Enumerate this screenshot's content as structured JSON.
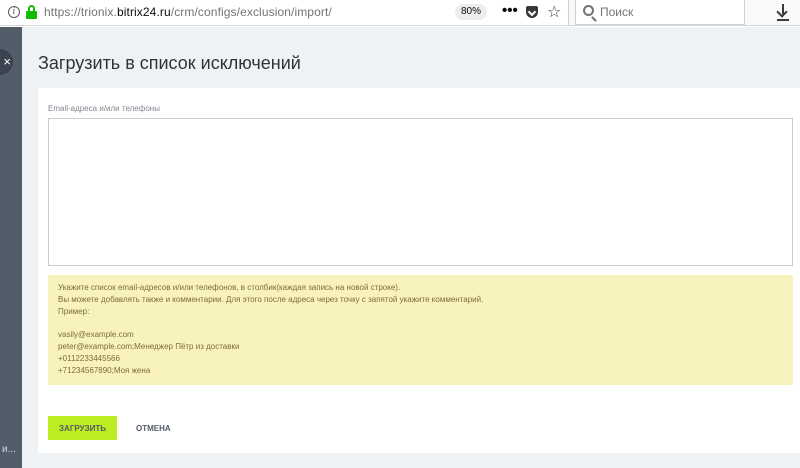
{
  "browser": {
    "url_prefix": "https://trionix.",
    "url_host": "bitrix24.ru",
    "url_path": "/crm/configs/exclusion/import/",
    "zoom": "80%",
    "search_placeholder": "Поиск",
    "icons": [
      "info-icon",
      "lock-icon",
      "menu-dots-icon",
      "pocket-icon",
      "star-icon",
      "search-icon",
      "download-icon"
    ]
  },
  "sidebar": {
    "close_glyph": "×",
    "cut_text": "и..."
  },
  "page": {
    "title": "Загрузить в список исключений",
    "field_label": "Email-адреса и/или телефоны",
    "textarea_value": "",
    "hint_lines": [
      "Укажите список email-адресов и/или телефонов, в столбик(каждая запись на новой строке).",
      "Вы можете добавлять также и комментарии. Для этого после адреса через точку с запятой укажите комментарий.",
      "Пример:",
      "",
      "vasily@example.com",
      "peter@example.com;Менеджер Пётр из доставки",
      "+0112233445566",
      "+71234567890;Моя жена"
    ],
    "upload_button": "ЗАГРУЗИТЬ",
    "cancel_button": "ОТМЕНА"
  },
  "colors": {
    "accent_button": "#bbed21",
    "hint_background": "#f8f3bc",
    "hint_text": "#7d6c3a",
    "secure_lock": "#12bc00"
  }
}
